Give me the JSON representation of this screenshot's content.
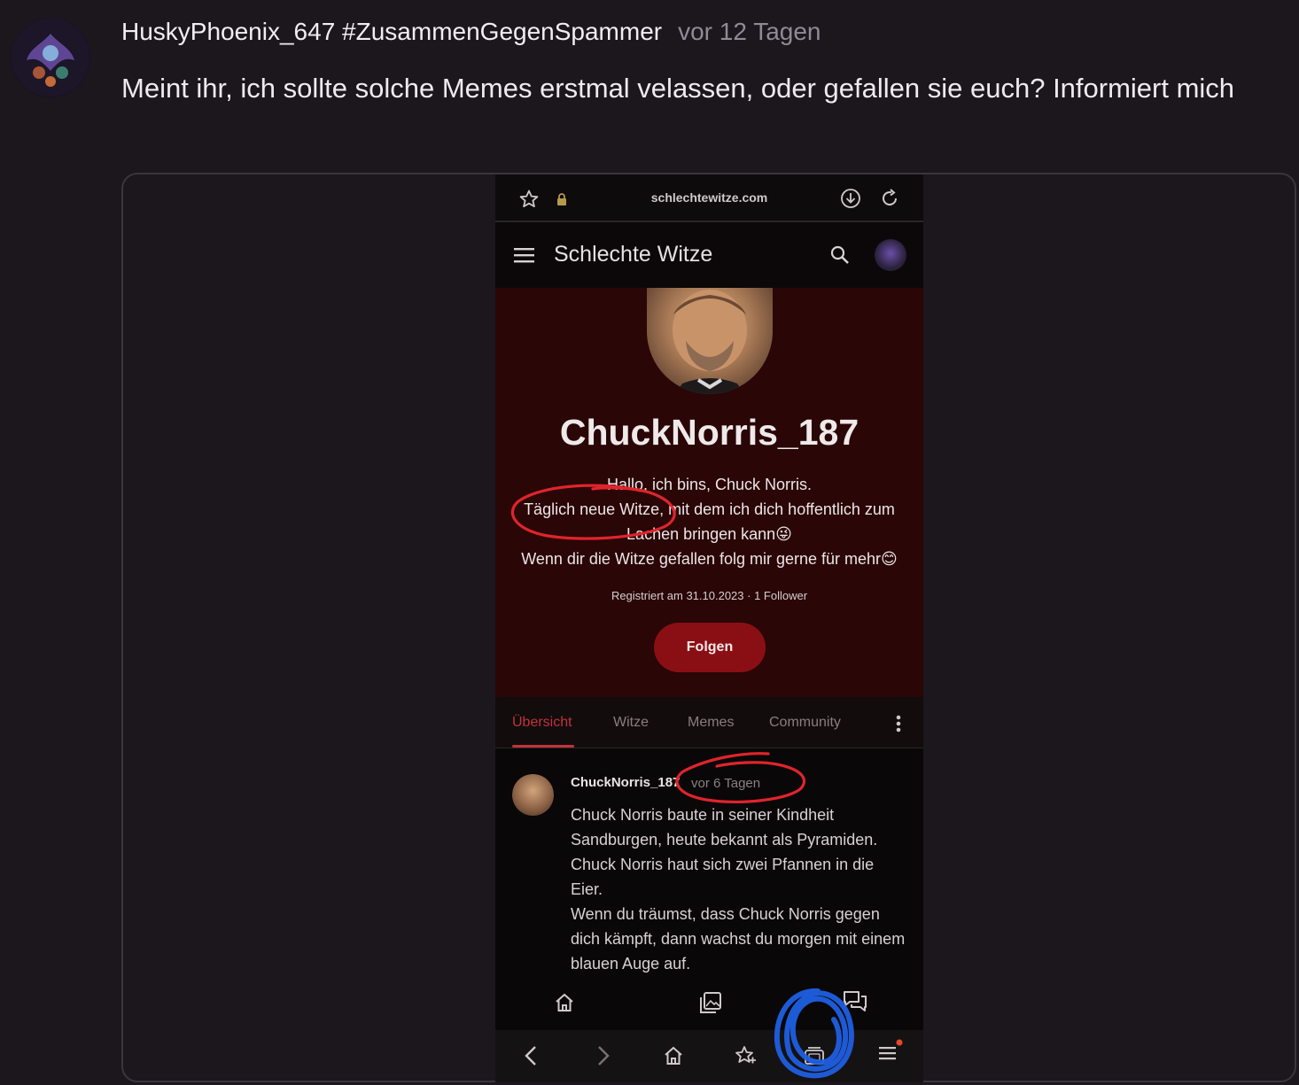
{
  "post": {
    "author": "HuskyPhoenix_647 #ZusammenGegenSpammer",
    "time": "vor 12 Tagen",
    "body": "Meint ihr, ich sollte solche Memes erstmal velassen, oder gefallen sie euch? Informiert mich"
  },
  "screenshot": {
    "url": "schlechtewitze.com",
    "app_title": "Schlechte Witze",
    "profile": {
      "name": "ChuckNorris_187",
      "bio_line1": "Hallo, ich bins, Chuck Norris.",
      "bio_line2": "Täglich neue Witze, mit dem ich dich hoffentlich zum Lachen bringen kann😜",
      "bio_line3": "Wenn dir die Witze gefallen folg mir gerne für mehr😊",
      "meta": "Registriert am 31.10.2023 · 1 Follower",
      "follow_label": "Folgen"
    },
    "tabs": [
      "Übersicht",
      "Witze",
      "Memes",
      "Community"
    ],
    "active_tab": "Übersicht",
    "feed_post": {
      "user": "ChuckNorris_187",
      "age": "vor 6 Tagen",
      "line1": "Chuck Norris baute in seiner Kindheit Sandburgen, heute bekannt als Pyramiden.",
      "line2": "Chuck Norris haut sich zwei Pfannen in die Eier.",
      "line3": "Wenn du träumst, dass Chuck Norris gegen dich kämpft, dann wachst du morgen mit einem blauen Auge auf."
    }
  },
  "colors": {
    "background": "#1b171d",
    "profile_banner": "#2a0606",
    "follow_button": "#8a0f14",
    "active_tab": "#c1333b",
    "annotation_red": "#e0242c",
    "annotation_blue": "#1f5fe0"
  },
  "icons": [
    "star-icon",
    "lock-icon",
    "download-icon",
    "reload-icon",
    "menu-icon",
    "search-icon",
    "home-icon",
    "gallery-icon",
    "chat-icon",
    "back-icon",
    "forward-icon",
    "bookmark-icon",
    "tabs-icon"
  ]
}
